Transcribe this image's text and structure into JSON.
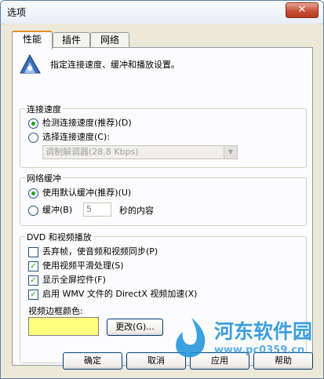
{
  "window": {
    "title": "选项"
  },
  "tabs": [
    {
      "label": "性能"
    },
    {
      "label": "插件"
    },
    {
      "label": "网络"
    }
  ],
  "intro": "指定连接速度、缓冲和播放设置。",
  "connection": {
    "legend": "连接速度",
    "detect_label": "检测连接速度(推荐)(D)",
    "choose_label": "选择连接速度(C):",
    "selected_speed": "调制解调器(28.8 Kbps)"
  },
  "buffer": {
    "legend": "网络缓冲",
    "default_label": "使用默认缓冲(推荐)(U)",
    "buffer_label": "缓冲(B)",
    "seconds_value": "5",
    "seconds_suffix": "秒的内容"
  },
  "dvd": {
    "legend": "DVD 和视频播放",
    "options": [
      {
        "label": "丢弃帧，使音频和视频同步(P)",
        "checked": false
      },
      {
        "label": "使用视频平滑处理(S)",
        "checked": true
      },
      {
        "label": "显示全屏控件(F)",
        "checked": true
      },
      {
        "label": "启用 WMV 文件的 DirectX 视频加速(X)",
        "checked": true
      }
    ],
    "border_color_label": "视频边框颜色:",
    "border_color": "#ffff80",
    "change_label": "更改(G)..."
  },
  "buttons": {
    "ok": "确定",
    "cancel": "取消",
    "apply": "应用",
    "help": "帮助"
  },
  "watermark": {
    "name": "河东软件园",
    "url": "www.pc0359.cn"
  },
  "colors": {
    "title_bar": "#e7eef7",
    "dialog_face": "#ece9d8",
    "focus_accent": "#e68b2c",
    "radio_dot": "#21a121"
  }
}
